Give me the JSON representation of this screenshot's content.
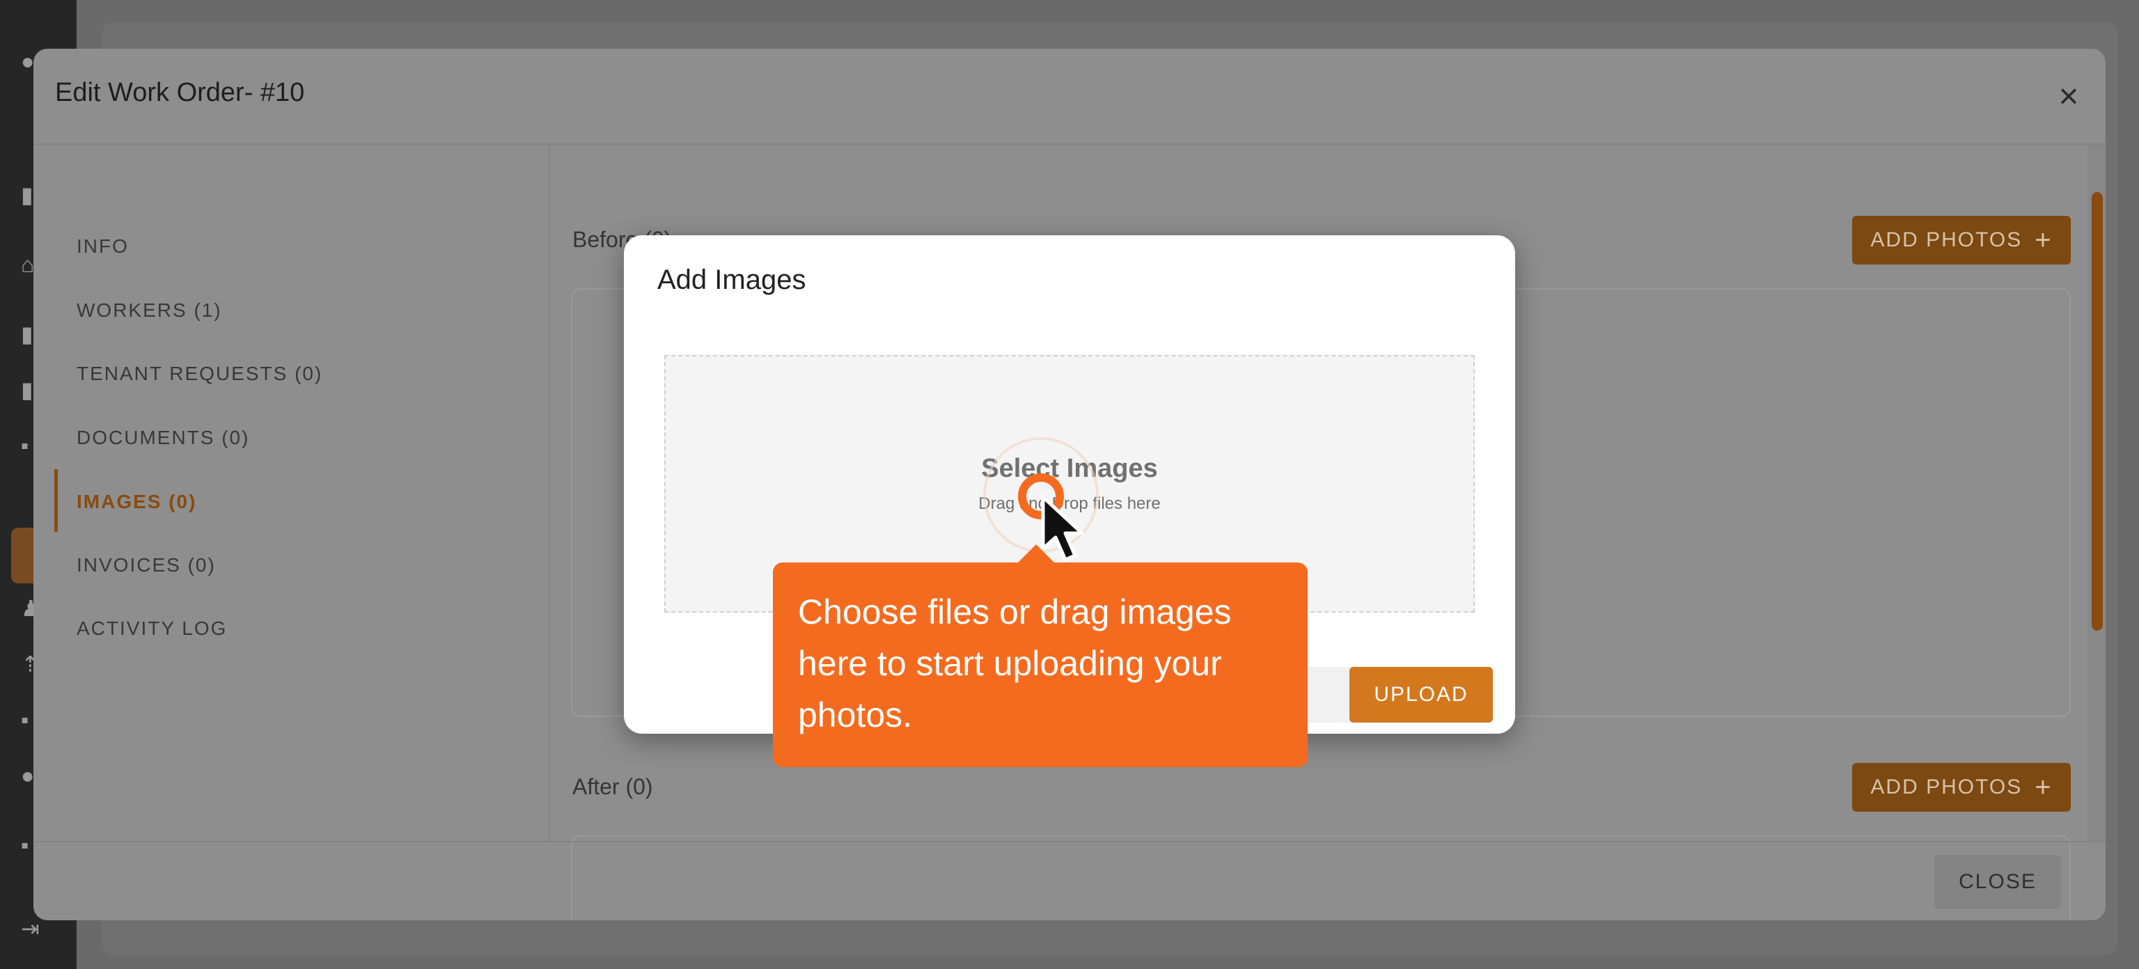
{
  "work_order_modal": {
    "title": "Edit Work Order- #10",
    "nav": [
      {
        "label": "INFO"
      },
      {
        "label": "WORKERS (1)"
      },
      {
        "label": "TENANT REQUESTS (0)"
      },
      {
        "label": "DOCUMENTS (0)"
      },
      {
        "label": "IMAGES (0)",
        "active": true
      },
      {
        "label": "INVOICES (0)"
      },
      {
        "label": "ACTIVITY LOG"
      }
    ],
    "before_label": "Before (0)",
    "after_label": "After (0)",
    "add_photos_label": "ADD PHOTOS",
    "close_label": "CLOSE"
  },
  "add_images_dialog": {
    "title": "Add Images",
    "dropzone_title": "Select Images",
    "dropzone_subtitle": "Drag and Drop files here",
    "upload_label": "UPLOAD"
  },
  "tooltip": {
    "text": "Choose files or drag images here to start uploading your photos."
  },
  "colors": {
    "accent": "#d4781e",
    "tooltip": "#f46b1f"
  },
  "icons": [
    "close-icon",
    "plus-icon",
    "cursor-icon",
    "collapse-sidebar-icon"
  ]
}
